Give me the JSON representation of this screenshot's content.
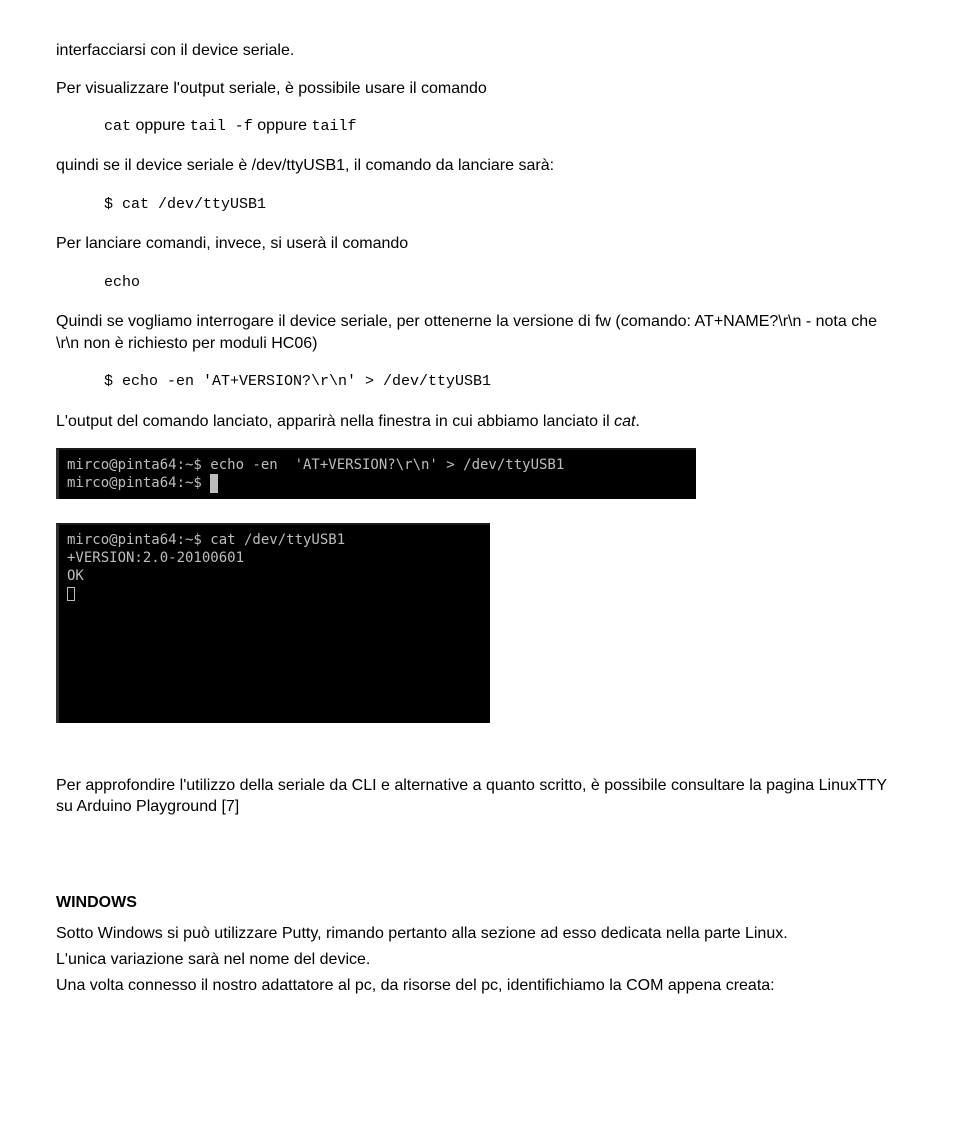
{
  "p0": "interfacciarsi con il device seriale.",
  "p1": "Per visualizzare l'output seriale, è possibile usare il comando",
  "code_cat": "cat",
  "gap1": "    oppure    ",
  "code_tail": "tail -f",
  "gap2": "    oppure    ",
  "code_tailf": "tailf",
  "p2": "quindi se il device seriale è /dev/ttyUSB1, il comando da lanciare sarà:",
  "cmd1": "$ cat /dev/ttyUSB1",
  "p3": "Per lanciare comandi, invece, si userà il comando",
  "code_echo": "echo",
  "p4": "Quindi se vogliamo interrogare il device seriale, per ottenerne la versione di fw (comando: AT+NAME?\\r\\n - nota che \\r\\n non è richiesto per moduli HC06)",
  "cmd2": "$ echo -en  'AT+VERSION?\\r\\n' > /dev/ttyUSB1",
  "p5a": "L'output del comando lanciato, apparirà nella finestra in cui abbiamo lanciato il ",
  "p5b": "cat",
  "p5c": ".",
  "terminal1": "mirco@pinta64:~$ echo -en  'AT+VERSION?\\r\\n' > /dev/ttyUSB1\nmirco@pinta64:~$ ",
  "terminal2_l1": "mirco@pinta64:~$ cat /dev/ttyUSB1",
  "terminal2_l2": "+VERSION:2.0-20100601",
  "terminal2_l3": "OK",
  "p6": "Per approfondire l'utilizzo della seriale da CLI e alternative a quanto scritto, è possibile consultare la pagina LinuxTTY su Arduino Playground [7]",
  "h_win": "WINDOWS",
  "p7": "Sotto Windows si può utilizzare Putty, rimando pertanto alla sezione ad esso dedicata nella parte Linux.",
  "p8": "L'unica variazione sarà nel nome del device.",
  "p9": "Una volta connesso il nostro adattatore al pc, da risorse del pc, identifichiamo la COM appena creata:"
}
